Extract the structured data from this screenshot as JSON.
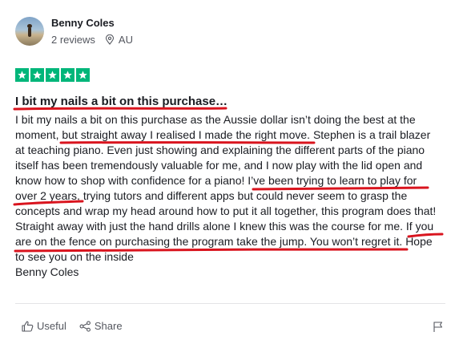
{
  "reviewer": {
    "name": "Benny Coles",
    "reviews": "2 reviews",
    "country": "AU"
  },
  "rating": {
    "stars": 5,
    "star_color": "#00b67a"
  },
  "review": {
    "title": "I bit my nails a bit on this purchase…",
    "lines": [
      "I bit my nails a bit on this purchase as the Aussie dollar isn’t doing the best at the",
      "moment, but straight away I realised I made the right move. Stephen is a trail blazer",
      "at teaching piano. Even just showing and explaining the different parts of the piano",
      "itself has been tremendously valuable for me, and I now play with the lid open and",
      "know how to shop with confidence for a piano! I’ve been trying to learn to play for",
      "over 2 years, trying tutors and different apps but could never seem to grasp the",
      "concepts and wrap my head around how to put it all together, this program does that!",
      "Straight away with just the hand drills alone I knew this was the course for me. If you",
      "are on the fence on purchasing the program take the jump. You won’t regret it. Hope",
      "to see you on the inside",
      "Benny Coles"
    ]
  },
  "annotation_color": "#d9141e",
  "actions": {
    "useful_label": "Useful",
    "share_label": "Share"
  },
  "icons": {
    "location": "location-pin-icon",
    "useful": "thumbs-up-icon",
    "share": "share-icon",
    "flag": "flag-icon",
    "star": "star-icon"
  }
}
